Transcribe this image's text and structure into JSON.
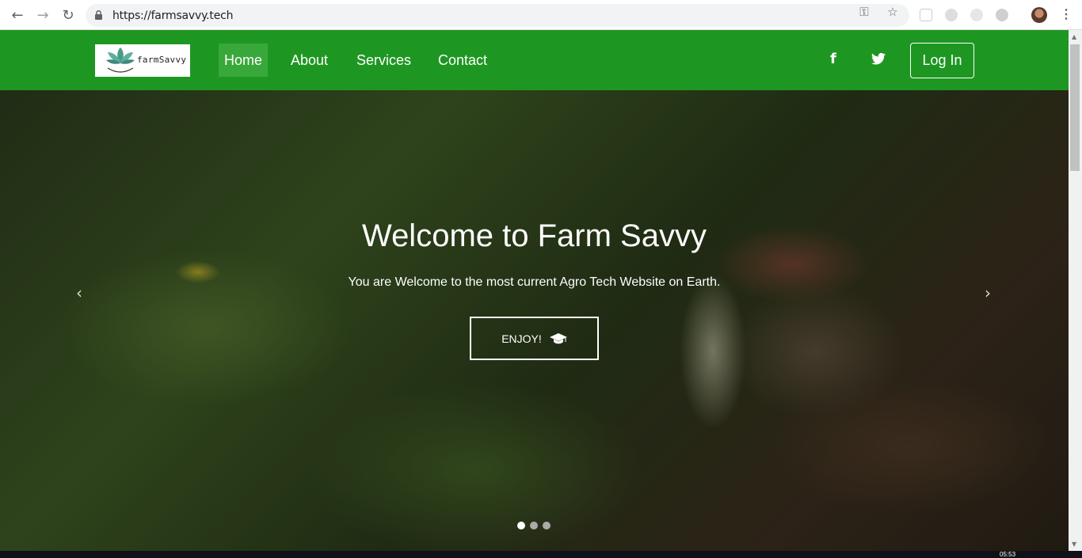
{
  "browser": {
    "url": "https://farmsavvy.tech",
    "icons": [
      "back-icon",
      "forward-icon",
      "reload-icon",
      "lock-icon",
      "key-icon",
      "star-icon"
    ]
  },
  "site": {
    "logo_text": "farmSavvy",
    "nav": [
      {
        "label": "Home",
        "active": true
      },
      {
        "label": "About"
      },
      {
        "label": "Services"
      },
      {
        "label": "Contact"
      }
    ],
    "social": {
      "facebook": "f",
      "twitter": "twitter-icon"
    },
    "login_label": "Log In",
    "header_color": "#1e9722"
  },
  "hero": {
    "title": "Welcome to Farm Savvy",
    "subtitle": "You are Welcome to the most current Agro Tech Website on Earth.",
    "button_label": "ENJOY!",
    "prev_arrow": "‹",
    "next_arrow": "›",
    "slides": 3,
    "active_slide": 1
  },
  "taskbar": {
    "clock": "05:53"
  }
}
